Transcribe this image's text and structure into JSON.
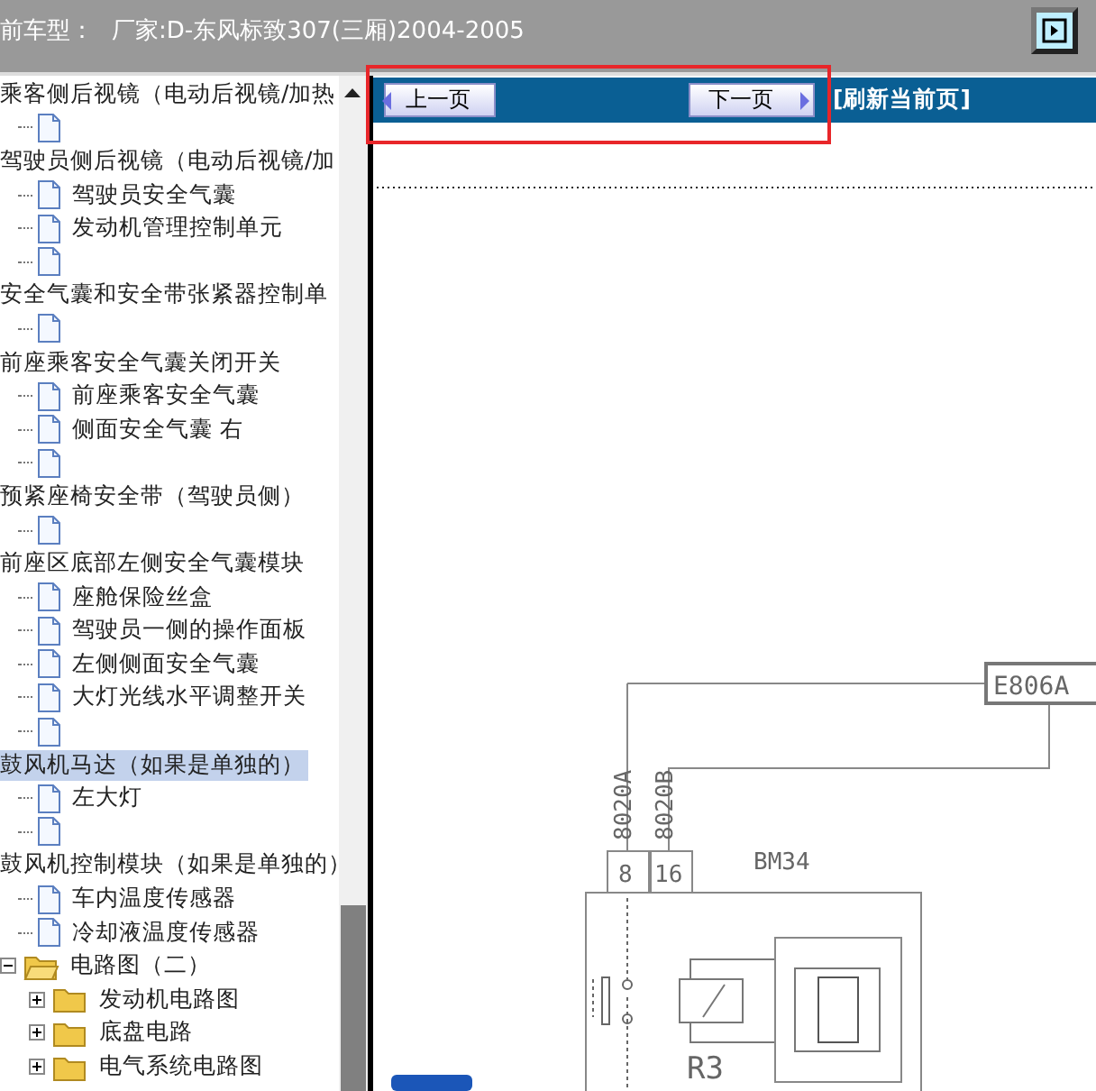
{
  "header": {
    "label": "前车型：",
    "model": "厂家:D-东风标致307(三厢)2004-2005"
  },
  "tree": [
    {
      "kind": "group",
      "label": "乘客侧后视镜（电动后视镜/加热",
      "selected": false,
      "children": [
        {
          "kind": "doc"
        }
      ]
    },
    {
      "kind": "group",
      "label": "驾驶员侧后视镜（电动后视镜/加",
      "selected": false,
      "children": [
        {
          "kind": "doc",
          "label": "驾驶员安全气囊"
        },
        {
          "kind": "doc",
          "label": "发动机管理控制单元"
        },
        {
          "kind": "doc"
        }
      ]
    },
    {
      "kind": "group",
      "label": "安全气囊和安全带张紧器控制单",
      "selected": false,
      "children": [
        {
          "kind": "doc"
        }
      ]
    },
    {
      "kind": "group",
      "label": "前座乘客安全气囊关闭开关",
      "selected": false,
      "children": [
        {
          "kind": "doc",
          "label": "前座乘客安全气囊"
        },
        {
          "kind": "doc",
          "label": "侧面安全气囊 右"
        },
        {
          "kind": "doc"
        }
      ]
    },
    {
      "kind": "group",
      "label": "预紧座椅安全带（驾驶员侧）",
      "selected": false,
      "children": [
        {
          "kind": "doc"
        }
      ]
    },
    {
      "kind": "group",
      "label": "前座区底部左侧安全气囊模块",
      "selected": false,
      "children": [
        {
          "kind": "doc",
          "label": "座舱保险丝盒"
        },
        {
          "kind": "doc",
          "label": "驾驶员一侧的操作面板"
        },
        {
          "kind": "doc",
          "label": "左侧侧面安全气囊"
        },
        {
          "kind": "doc",
          "label": "大灯光线水平调整开关"
        },
        {
          "kind": "doc"
        }
      ]
    },
    {
      "kind": "group",
      "label": "鼓风机马达（如果是单独的）",
      "selected": true,
      "children": [
        {
          "kind": "doc",
          "label": "左大灯"
        },
        {
          "kind": "doc"
        }
      ]
    },
    {
      "kind": "group",
      "label": "鼓风机控制模块（如果是单独的）",
      "selected": false,
      "children": [
        {
          "kind": "doc",
          "label": "车内温度传感器"
        },
        {
          "kind": "doc",
          "label": "冷却液温度传感器"
        }
      ]
    },
    {
      "kind": "folder",
      "label": "电路图（二）",
      "expanded": true,
      "children": [
        {
          "kind": "folder",
          "label": "发动机电路图",
          "expanded": false
        },
        {
          "kind": "folder",
          "label": "底盘电路",
          "expanded": false
        },
        {
          "kind": "folder",
          "label": "电气系统电路图",
          "expanded": false
        }
      ]
    }
  ],
  "toolbar": {
    "prev": "上一页",
    "next": "下一页",
    "refresh": "[刷新当前页]"
  },
  "diagram": {
    "connector": "E806A",
    "wire_a": "8020A",
    "wire_b": "8020B",
    "pin_a": "8",
    "pin_b": "16",
    "module": "BM34",
    "relay": "R3"
  }
}
